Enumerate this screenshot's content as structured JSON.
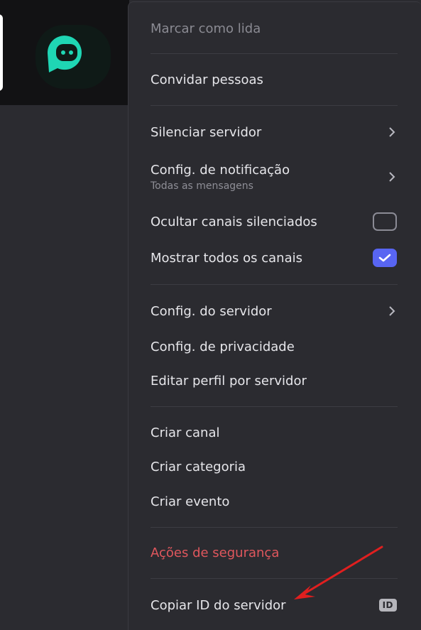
{
  "menu": {
    "mark_read": "Marcar como lida",
    "invite": "Convidar pessoas",
    "mute_server": "Silenciar servidor",
    "notification_settings": "Config. de notificação",
    "notification_settings_sub": "Todas as mensagens",
    "hide_muted": "Ocultar canais silenciados",
    "hide_muted_checked": false,
    "show_all": "Mostrar todos os canais",
    "show_all_checked": true,
    "server_settings": "Config. do servidor",
    "privacy_settings": "Config. de privacidade",
    "edit_profile": "Editar perfil por servidor",
    "create_channel": "Criar canal",
    "create_category": "Criar categoria",
    "create_event": "Criar evento",
    "security_actions": "Ações de segurança",
    "copy_id": "Copiar ID do servidor",
    "id_badge": "ID"
  },
  "colors": {
    "background": "#2b2b30",
    "text": "#e6e6ea",
    "muted": "#8b8b93",
    "danger": "#e0575d",
    "accent": "#5865f2",
    "server_icon": "#1fd6b4",
    "arrow": "#e01f1f"
  },
  "icons": {
    "server": "robot-chat-icon",
    "submenu": "chevron-right-icon",
    "check": "check-icon",
    "arrow": "red-arrow-annotation"
  }
}
